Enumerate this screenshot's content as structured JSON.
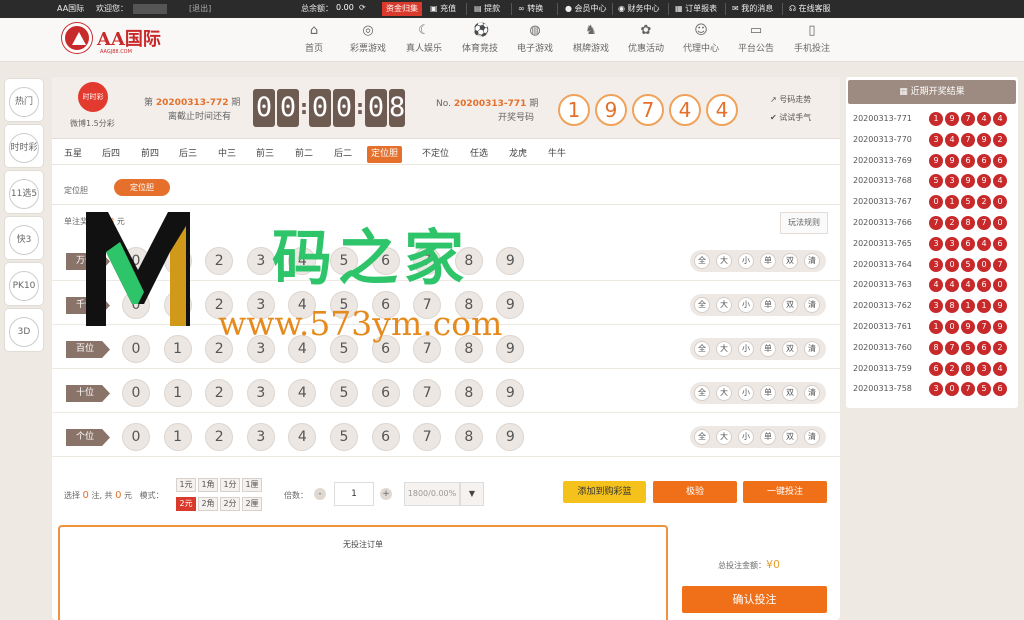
{
  "topbar": {
    "brand": "AA国际",
    "welcome": "欢迎您：",
    "logout": "[退出]",
    "balance_label": "总余额：",
    "balance_value": "0.00",
    "recharge_badge": "资金归集",
    "links": [
      "充值",
      "提款",
      "转换",
      "会员中心",
      "财务中心",
      "订单报表",
      "我的消息",
      "在线客服"
    ]
  },
  "logo": {
    "name": "AA国际",
    "sub": "AAGJ88.COM"
  },
  "nav": [
    "首页",
    "彩票游戏",
    "真人娱乐",
    "体育竞技",
    "电子游戏",
    "棋牌游戏",
    "优惠活动",
    "代理中心",
    "平台公告",
    "手机投注"
  ],
  "left_menu": [
    "热门",
    "时时彩",
    "11选5",
    "快3",
    "PK10",
    "3D"
  ],
  "game": {
    "logo_text": "时时彩",
    "name": "微博1.5分彩",
    "period_prefix": "第",
    "period": "20200313-772",
    "period_suffix": "期",
    "deadline_label": "离截止时间还有",
    "timer": [
      "0",
      "0",
      "0",
      "0",
      "0",
      "8"
    ],
    "last_prefix": "No.",
    "last_period": "20200313-771",
    "last_suffix": "期",
    "last_label": "开奖号码",
    "last_numbers": [
      "1",
      "9",
      "7",
      "4",
      "4"
    ],
    "trend_label": "号码走势",
    "trial_label": "试试手气"
  },
  "tabs": [
    "五星",
    "后四",
    "前四",
    "后三",
    "中三",
    "前三",
    "前二",
    "后二",
    "定位胆",
    "不定位",
    "任选",
    "龙虎",
    "牛牛"
  ],
  "active_tab": "定位胆",
  "subplay": {
    "label": "定位胆",
    "active": "定位胆"
  },
  "prize": {
    "prefix": "单注奖金：",
    "value": "18",
    "suffix": "元"
  },
  "rules_button": "玩法规则",
  "positions": [
    "万位",
    "千位",
    "百位",
    "十位",
    "个位"
  ],
  "digits": [
    "0",
    "1",
    "2",
    "3",
    "4",
    "5",
    "6",
    "7",
    "8",
    "9"
  ],
  "quick_picks": [
    "全",
    "大",
    "小",
    "单",
    "双",
    "清"
  ],
  "summary": {
    "select_label": "选择",
    "count": "0",
    "unit_zhu": "注, 共",
    "amount": "0",
    "unit_yuan": "元",
    "mode_label": "模式："
  },
  "units": [
    "1元",
    "1角",
    "1分",
    "1厘",
    "2元",
    "2角",
    "2分",
    "2厘"
  ],
  "active_unit": "2元",
  "multiplier": {
    "label": "倍数：",
    "minus": "-",
    "value": "1",
    "plus": "+"
  },
  "rebate": {
    "value": "1800/0.00%"
  },
  "actions": {
    "add_cart": "添加到购彩篮",
    "follow": "极验",
    "quick_bet": "一键投注"
  },
  "cart": {
    "empty": "无投注订单"
  },
  "total": {
    "label": "总投注金额：",
    "value": "¥0"
  },
  "confirm": "确认投注",
  "recent": {
    "title": "近期开奖结果",
    "rows": [
      {
        "period": "20200313-771",
        "nums": [
          "1",
          "9",
          "7",
          "4",
          "4"
        ]
      },
      {
        "period": "20200313-770",
        "nums": [
          "3",
          "4",
          "7",
          "9",
          "2"
        ]
      },
      {
        "period": "20200313-769",
        "nums": [
          "9",
          "9",
          "6",
          "6",
          "6"
        ]
      },
      {
        "period": "20200313-768",
        "nums": [
          "5",
          "3",
          "9",
          "9",
          "4"
        ]
      },
      {
        "period": "20200313-767",
        "nums": [
          "0",
          "1",
          "5",
          "2",
          "0"
        ]
      },
      {
        "period": "20200313-766",
        "nums": [
          "7",
          "2",
          "8",
          "7",
          "0"
        ]
      },
      {
        "period": "20200313-765",
        "nums": [
          "3",
          "3",
          "6",
          "4",
          "6"
        ]
      },
      {
        "period": "20200313-764",
        "nums": [
          "3",
          "0",
          "5",
          "0",
          "7"
        ]
      },
      {
        "period": "20200313-763",
        "nums": [
          "4",
          "4",
          "4",
          "6",
          "0"
        ]
      },
      {
        "period": "20200313-762",
        "nums": [
          "3",
          "8",
          "1",
          "1",
          "9"
        ]
      },
      {
        "period": "20200313-761",
        "nums": [
          "1",
          "0",
          "9",
          "7",
          "9"
        ]
      },
      {
        "period": "20200313-760",
        "nums": [
          "8",
          "7",
          "5",
          "6",
          "2"
        ]
      },
      {
        "period": "20200313-759",
        "nums": [
          "6",
          "2",
          "8",
          "3",
          "4"
        ]
      },
      {
        "period": "20200313-758",
        "nums": [
          "3",
          "0",
          "7",
          "5",
          "6"
        ]
      }
    ]
  },
  "watermark": {
    "cn": "码之家",
    "url": "www.573ym.com"
  },
  "colors": {
    "accent": "#e4702c",
    "red": "#c8292b",
    "green": "#2ec46a"
  }
}
